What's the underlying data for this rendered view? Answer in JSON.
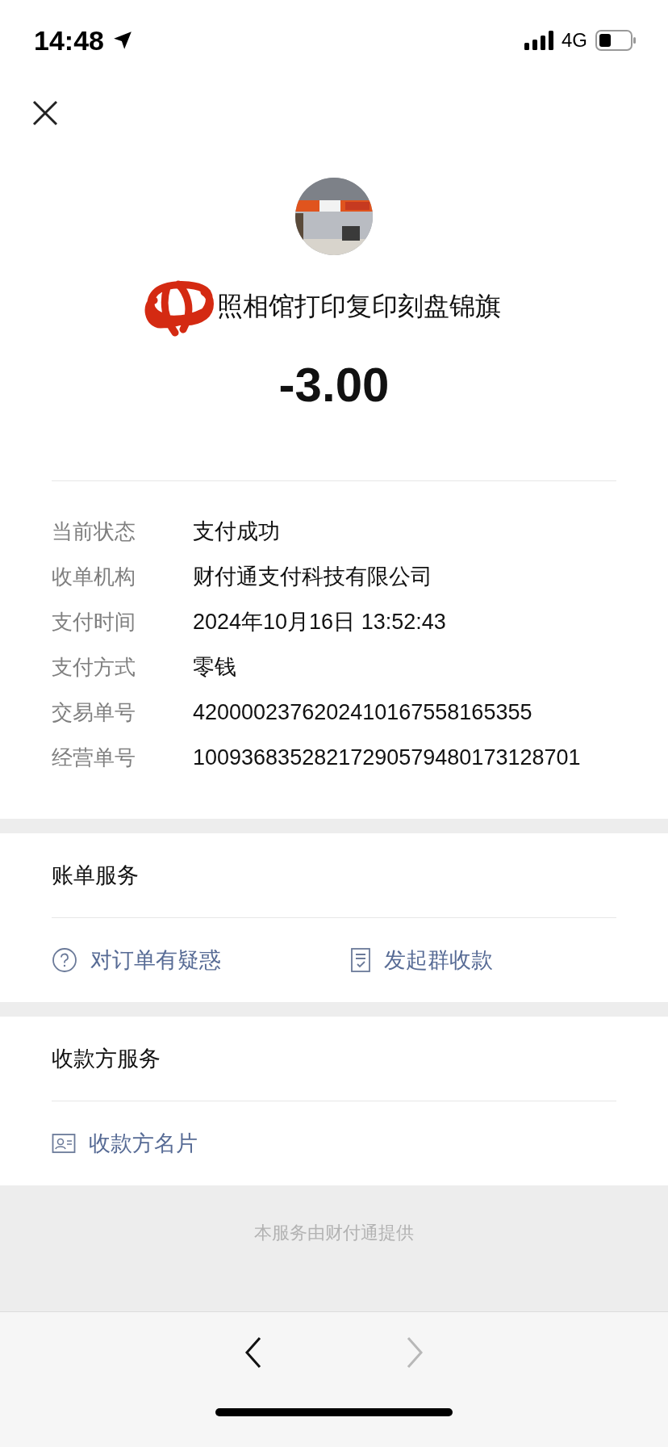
{
  "status_bar": {
    "time": "14:48",
    "network": "4G"
  },
  "merchant": {
    "name": "照相馆打印复印刻盘锦旗",
    "amount": "-3.00"
  },
  "details": [
    {
      "label": "当前状态",
      "value": "支付成功"
    },
    {
      "label": "收单机构",
      "value": "财付通支付科技有限公司"
    },
    {
      "label": "支付时间",
      "value": "2024年10月16日 13:52:43"
    },
    {
      "label": "支付方式",
      "value": "零钱"
    },
    {
      "label": "交易单号",
      "value": "4200002376202410167558165355"
    },
    {
      "label": "经营单号",
      "value": "10093683528217290579480173128701"
    }
  ],
  "bill_services": {
    "title": "账单服务",
    "actions": [
      {
        "label": "对订单有疑惑",
        "kind": "question"
      },
      {
        "label": "发起群收款",
        "kind": "receipt"
      }
    ]
  },
  "payee_services": {
    "title": "收款方服务",
    "actions": [
      {
        "label": "收款方名片",
        "kind": "card"
      }
    ]
  },
  "footer": "本服务由财付通提供",
  "toolbar": {
    "back": {
      "disabled": false
    },
    "forward": {
      "disabled": true
    }
  }
}
